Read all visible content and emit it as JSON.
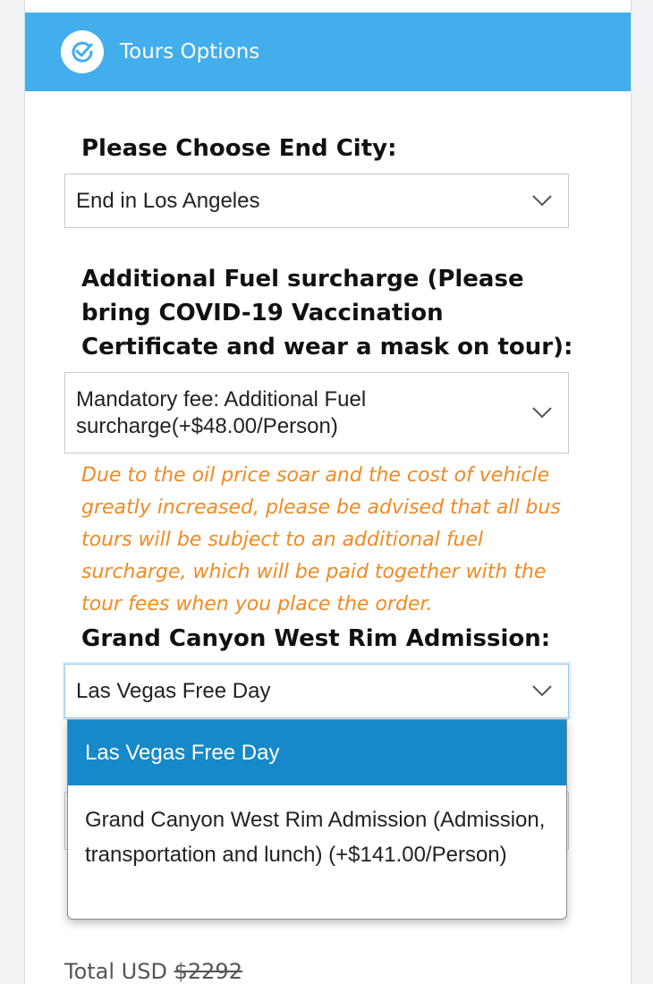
{
  "header": {
    "title": "Tours Options",
    "icon": "check-circle-icon",
    "color": "#42aeeb"
  },
  "end_city": {
    "label": "Please Choose End City:",
    "selected": "End in Los Angeles"
  },
  "fuel": {
    "label": "Additional Fuel surcharge (Please bring COVID-19 Vaccination Certificate and wear a mask on tour):",
    "selected": "Mandatory fee: Additional Fuel surcharge(+$48.00/Person)",
    "notice": "Due to the oil price soar and the cost of vehicle greatly increased, please be advised that all bus tours will be subject to an additional fuel surcharge, which will be paid together with the tour fees when you place the order.",
    "notice_color": "#f08a24"
  },
  "admission": {
    "label": "Grand Canyon West Rim Admission:",
    "selected": "Las Vegas Free Day",
    "options": [
      {
        "label": "Las Vegas Free Day",
        "selected": true
      },
      {
        "label": "Grand Canyon West Rim Admission (Admission, transportation and lunch) (+$141.00/Person)",
        "selected": false
      }
    ],
    "highlight_color": "#1589c9"
  },
  "total": {
    "label": "Total USD",
    "original_price": "$2292"
  }
}
